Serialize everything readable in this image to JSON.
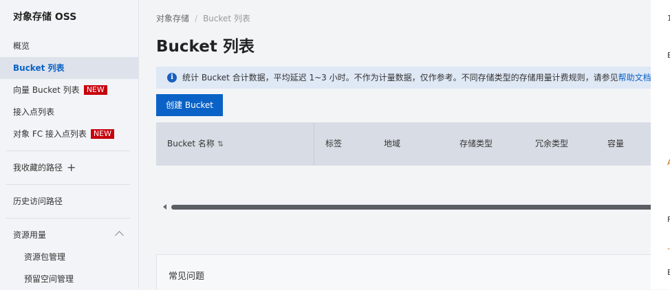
{
  "sidebar": {
    "title": "对象存储 OSS",
    "items": [
      {
        "label": "概览"
      },
      {
        "label": "Bucket 列表"
      },
      {
        "label": "向量 Bucket 列表",
        "badge": "NEW"
      },
      {
        "label": "接入点列表"
      },
      {
        "label": "对象 FC 接入点列表",
        "badge": "NEW"
      },
      {
        "label": "我收藏的路径",
        "icon": "plus-icon"
      },
      {
        "label": "历史访问路径"
      },
      {
        "label": "资源用量",
        "icon": "chevron-up-icon"
      },
      {
        "label": "资源包管理"
      },
      {
        "label": "预留空间管理"
      }
    ],
    "plus_glyph": "+"
  },
  "breadcrumb": {
    "root": "对象存储",
    "separator": "/",
    "current": "Bucket 列表"
  },
  "page": {
    "title": "Bucket 列表"
  },
  "notice": {
    "text": "统计 Bucket 合计数据，平均延迟 1~3 小时。不作为计量数据，仅作参考。不同存储类型的存储用量计费规则，请参见",
    "link": "帮助文档",
    "tail": "。"
  },
  "toolbar": {
    "create_label": "创建 Bucket"
  },
  "table": {
    "columns": [
      "Bucket 名称",
      "标签",
      "地域",
      "存储类型",
      "冗余类型",
      "容量"
    ],
    "sort_glyph": "⇅"
  },
  "faq": {
    "title": "常见问题"
  },
  "right_strip": {
    "chars": [
      "1",
      "E",
      "A",
      "F",
      "-",
      "E"
    ]
  },
  "colors": {
    "accent": "#0a62c6",
    "badge": "#c7000b",
    "notice_bg": "#dfe8f5"
  }
}
